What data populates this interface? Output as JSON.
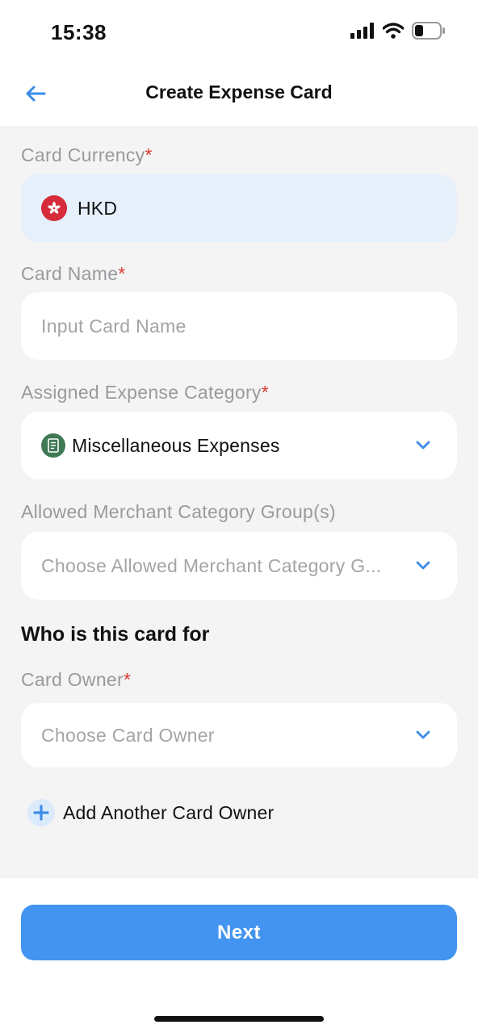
{
  "status_bar": {
    "time": "15:38"
  },
  "header": {
    "title": "Create Expense Card",
    "back_icon": "arrow-left-icon"
  },
  "form": {
    "currency": {
      "label": "Card Currency",
      "required_mark": "*",
      "value": "HKD",
      "icon": "hong-kong-flag-icon"
    },
    "card_name": {
      "label": "Card Name",
      "required_mark": "*",
      "placeholder": "Input Card Name"
    },
    "expense_category": {
      "label": "Assigned Expense Category",
      "required_mark": "*",
      "value": "Miscellaneous Expenses",
      "icon": "receipt-icon"
    },
    "merchant_groups": {
      "label": "Allowed Merchant Category Group(s)",
      "placeholder": "Choose Allowed Merchant Category G..."
    },
    "section_title": "Who is this card for",
    "card_owner": {
      "label": "Card Owner",
      "required_mark": "*",
      "placeholder": "Choose Card Owner"
    },
    "add_owner_label": "Add Another Card Owner"
  },
  "footer": {
    "next_label": "Next"
  },
  "colors": {
    "accent": "#4394f0",
    "required": "#d93a35",
    "background": "#f4f4f5",
    "currency_field": "#e6f0fb"
  }
}
